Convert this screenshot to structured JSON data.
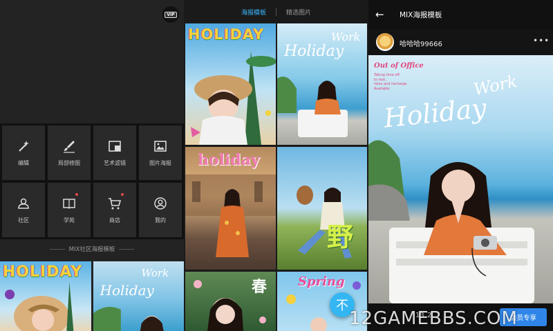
{
  "panel1": {
    "vip_badge": "VIP",
    "tools": [
      {
        "label": "编辑",
        "icon": "magic-wand-icon",
        "dot": false
      },
      {
        "label": "局部修图",
        "icon": "brush-icon",
        "dot": false
      },
      {
        "label": "艺术滤镜",
        "icon": "filter-icon",
        "dot": false
      },
      {
        "label": "图片海报",
        "icon": "poster-icon",
        "dot": false
      },
      {
        "label": "社区",
        "icon": "community-icon",
        "dot": false
      },
      {
        "label": "学苑",
        "icon": "book-icon",
        "dot": true
      },
      {
        "label": "商店",
        "icon": "cart-icon",
        "dot": true
      },
      {
        "label": "我的",
        "icon": "profile-icon",
        "dot": false
      }
    ],
    "section_title": "MIX社区海报模板"
  },
  "panel2": {
    "tabs": [
      {
        "label": "海报模板",
        "active": true
      },
      {
        "label": "精选图片",
        "active": false
      }
    ],
    "cards": [
      {
        "word": "HOLIDAY"
      },
      {
        "word": "Holiday",
        "sub": "Work"
      },
      {
        "word": "holiday"
      },
      {
        "word": "野"
      },
      {
        "word": "春"
      },
      {
        "word": "Spring"
      }
    ],
    "fab_glyph": "不",
    "colors": {
      "accent": "#3bb8ff",
      "fab": "#33b6f2"
    }
  },
  "panel3": {
    "title": "MIX海报模板",
    "username": "哈哈哈99666",
    "poster": {
      "out_of_office": "Out of Office",
      "tagline": "Taking time off\nto rest,\nrelax and recharge.\nAvailable",
      "work": "Work",
      "holiday": "Holiday"
    },
    "likes": "13",
    "comments": "2",
    "use_button": "会员专享",
    "watermark": "12GAMEBBS.COM",
    "colors": {
      "button": "#2f86e8"
    }
  }
}
